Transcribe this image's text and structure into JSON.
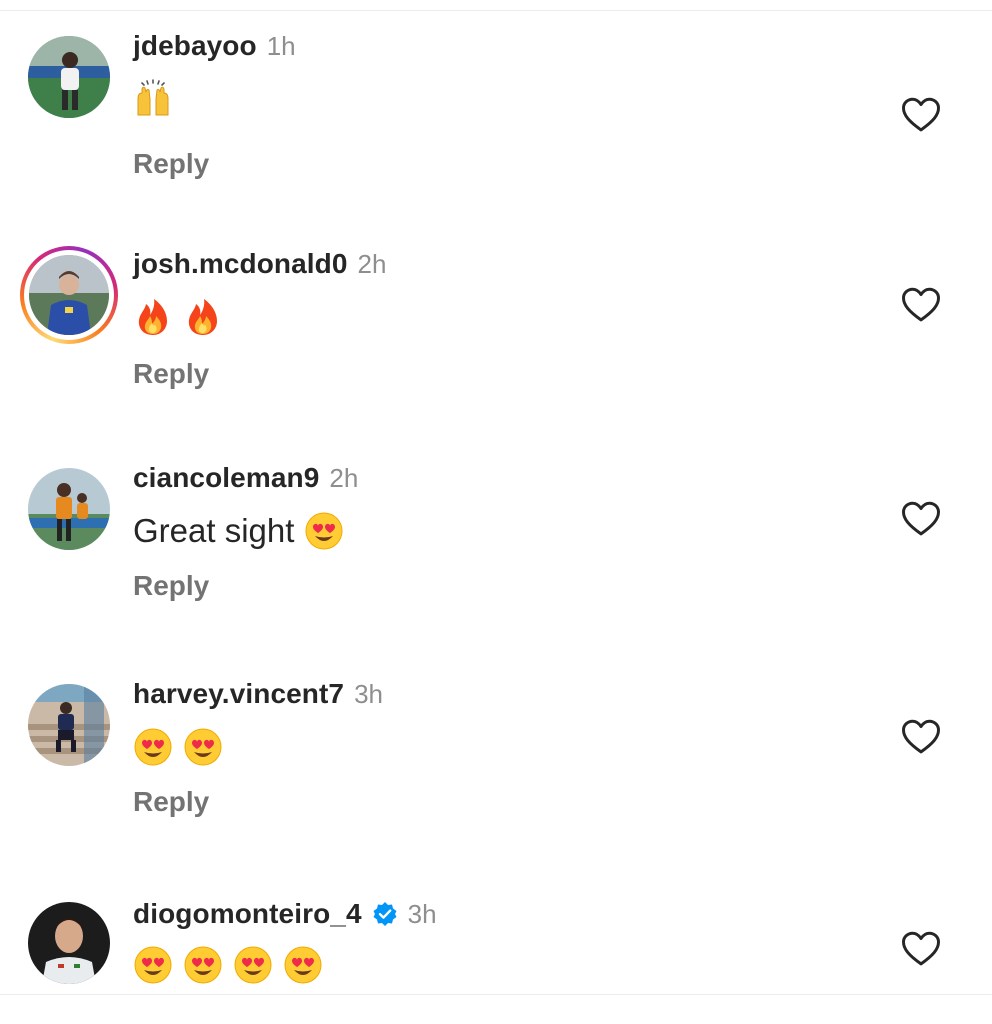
{
  "comments": [
    {
      "username": "jdebayoo",
      "time": "1h",
      "text": "",
      "emojis": [
        "raised-hands"
      ],
      "reply_label": "Reply",
      "has_story": false,
      "verified": false
    },
    {
      "username": "josh.mcdonald0",
      "time": "2h",
      "text": "",
      "emojis": [
        "fire",
        "fire"
      ],
      "reply_label": "Reply",
      "has_story": true,
      "verified": false
    },
    {
      "username": "ciancoleman9",
      "time": "2h",
      "text": "Great sight",
      "emojis": [
        "heart-eyes"
      ],
      "reply_label": "Reply",
      "has_story": false,
      "verified": false
    },
    {
      "username": "harvey.vincent7",
      "time": "3h",
      "text": "",
      "emojis": [
        "heart-eyes",
        "heart-eyes"
      ],
      "reply_label": "Reply",
      "has_story": false,
      "verified": false
    },
    {
      "username": "diogomonteiro_4",
      "time": "3h",
      "text": "",
      "emojis": [
        "heart-eyes",
        "heart-eyes",
        "heart-eyes",
        "heart-eyes"
      ],
      "reply_label": "",
      "has_story": false,
      "verified": true
    }
  ],
  "colors": {
    "username": "#262626",
    "meta": "#8e8e8e",
    "reply": "#737373",
    "verified_blue": "#0095f6",
    "story_ring": [
      "#feda75",
      "#fa7e1e",
      "#d62976",
      "#962fbf"
    ]
  }
}
